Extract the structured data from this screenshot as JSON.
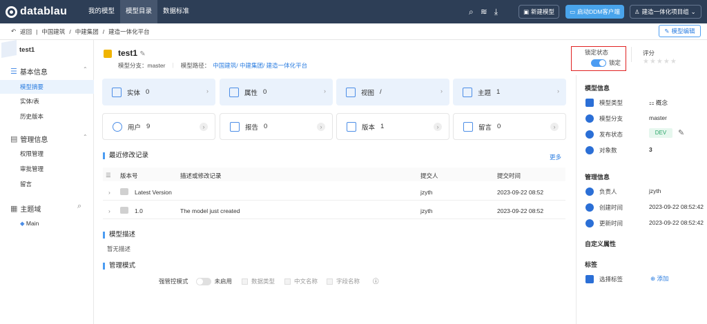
{
  "topbar": {
    "brand": "datablau",
    "nav": [
      "我的模型",
      "模型目录",
      "数据标准"
    ],
    "active_nav": 1,
    "new_model": "新建模型",
    "ddm_client": "启动DDM客户端",
    "project": "建造一体化项目组"
  },
  "subbar": {
    "back": "返回",
    "crumbs": [
      "中国建筑",
      "中建集团",
      "建造一体化平台"
    ],
    "edit_button": "模型编辑"
  },
  "leftnav": {
    "model_name": "test1",
    "basic_info": "基本信息",
    "basic_items": [
      "模型摘要",
      "实体/表",
      "历史版本"
    ],
    "mgmt_info": "管理信息",
    "mgmt_items": [
      "权限管理",
      "审批管理",
      "留言"
    ],
    "domain": "主题域",
    "domain_items": [
      "Main"
    ]
  },
  "header": {
    "title": "test1",
    "branch_label": "模型分支：master",
    "path_label": "模型路径：",
    "path_value": "中国建筑/ 中建集团/ 建造一体化平台",
    "lock_status_label": "锁定状态",
    "lock_value": "锁定",
    "rating_label": "评分"
  },
  "cards_row1": [
    {
      "label": "实体",
      "value": "0"
    },
    {
      "label": "属性",
      "value": "0"
    },
    {
      "label": "视图",
      "value": "/"
    },
    {
      "label": "主题",
      "value": "1"
    }
  ],
  "cards_row2": [
    {
      "label": "用户",
      "value": "9"
    },
    {
      "label": "报告",
      "value": "0"
    },
    {
      "label": "版本",
      "value": "1"
    },
    {
      "label": "留言",
      "value": "0"
    }
  ],
  "records": {
    "title": "最近修改记录",
    "more": "更多",
    "columns": [
      "版本号",
      "描述或修改记录",
      "提交人",
      "提交时间"
    ],
    "rows": [
      {
        "version": "Latest Version",
        "desc": "",
        "user": "jzyth",
        "time": "2023-09-22 08:52"
      },
      {
        "version": "1.0",
        "desc": "The model just created",
        "user": "jzyth",
        "time": "2023-09-22 08:52"
      }
    ]
  },
  "description": {
    "title": "模型描述",
    "value": "暂无描述"
  },
  "mode": {
    "title": "管理模式",
    "strict_label": "强管控模式",
    "strict_value": "未启用",
    "options": [
      "数据类型",
      "中文名称",
      "字段名称"
    ]
  },
  "right": {
    "model_info_title": "模型信息",
    "model_type_label": "模型类型",
    "model_type_value": "概念",
    "branch_label": "模型分支",
    "branch_value": "master",
    "publish_label": "发布状态",
    "publish_value": "DEV",
    "objects_label": "对象数",
    "objects_value": "3",
    "mgmt_title": "管理信息",
    "owner_label": "负责人",
    "owner_value": "jzyth",
    "created_label": "创建时间",
    "created_value": "2023-09-22 08:52:42",
    "updated_label": "更新时间",
    "updated_value": "2023-09-22 08:52:42",
    "custom_title": "自定义属性",
    "tags_title": "标签",
    "select_tag": "选择标签",
    "add_tag": "添加"
  }
}
